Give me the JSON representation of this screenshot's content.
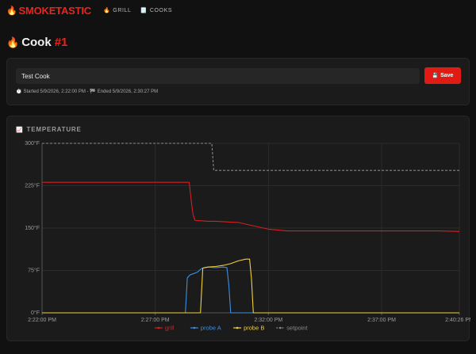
{
  "brand": {
    "name": "SMOKETASTIC",
    "icon": "flame-icon"
  },
  "nav": {
    "grill": {
      "label": "GRILL",
      "icon": "flame-icon"
    },
    "cooks": {
      "label": "COOKS",
      "icon": "notepad-icon"
    }
  },
  "page": {
    "title_prefix": "Cook",
    "title_number": "#1"
  },
  "cook": {
    "name_value": "Test Cook",
    "save_label": "Save",
    "started": "Started 5/9/2026, 2:22:00 PM",
    "separator": " - ",
    "ended": "Ended 5/9/2026, 2:30:27 PM"
  },
  "colors": {
    "accent": "#e8241e",
    "grill": "#d42020",
    "probe_a": "#3d8fe0",
    "probe_b": "#f2cf3c",
    "setpoint": "#8a8a8a"
  },
  "chart_data": {
    "type": "line",
    "title": "TEMPERATURE",
    "y_tick_labels": [
      "0°F",
      "75°F",
      "150°F",
      "225°F",
      "300°F"
    ],
    "y_ticks": [
      0,
      75,
      150,
      225,
      300
    ],
    "ylim": [
      0,
      300
    ],
    "x_tick_labels": [
      "2:22:00 PM",
      "2:27:00 PM",
      "2:32:00 PM",
      "2:37:00 PM",
      "2:40:26 PM"
    ],
    "x_ticks": [
      0,
      300,
      600,
      900,
      1106
    ],
    "xlim": [
      0,
      1106
    ],
    "grid": true,
    "legend_position": "bottom",
    "series": [
      {
        "name": "grill",
        "color": "#d42020",
        "x": [
          0,
          50,
          100,
          150,
          200,
          250,
          300,
          350,
          390,
          395,
          400,
          405,
          410,
          420,
          440,
          460,
          490,
          520,
          560,
          600,
          650,
          700,
          800,
          900,
          1000,
          1050,
          1106
        ],
        "y": [
          231,
          231,
          231,
          231,
          231,
          231,
          231,
          231,
          231,
          200,
          175,
          164,
          163,
          163,
          162,
          162,
          161,
          160,
          154,
          148,
          145,
          145,
          145,
          145,
          145,
          145,
          144
        ]
      },
      {
        "name": "probe A",
        "color": "#3d8fe0",
        "x": [
          0,
          100,
          200,
          300,
          380,
          385,
          392,
          400,
          412,
          420,
          425,
          430,
          440,
          460,
          480,
          490,
          495,
          500,
          505,
          600,
          700,
          800,
          900,
          1000,
          1106
        ],
        "y": [
          0,
          0,
          0,
          0,
          0,
          62,
          67,
          69,
          72,
          77,
          79,
          80,
          81,
          80,
          81,
          80,
          50,
          0,
          0,
          0,
          0,
          0,
          0,
          0,
          0
        ]
      },
      {
        "name": "probe B",
        "color": "#f2cf3c",
        "x": [
          0,
          100,
          200,
          300,
          400,
          420,
          426,
          432,
          440,
          460,
          480,
          500,
          520,
          540,
          550,
          555,
          560,
          600,
          700,
          800,
          900,
          1000,
          1106
        ],
        "y": [
          0,
          0,
          0,
          0,
          0,
          0,
          79,
          80,
          81,
          82,
          84,
          87,
          92,
          95,
          95,
          60,
          0,
          0,
          0,
          0,
          0,
          0,
          0
        ]
      },
      {
        "name": "setpoint",
        "color": "#8a8a8a",
        "dashed": true,
        "x": [
          0,
          100,
          200,
          300,
          400,
          450,
          455,
          460,
          600,
          800,
          1000,
          1106
        ],
        "y": [
          300,
          300,
          300,
          300,
          300,
          300,
          252,
          252,
          252,
          252,
          252,
          252
        ]
      }
    ]
  }
}
